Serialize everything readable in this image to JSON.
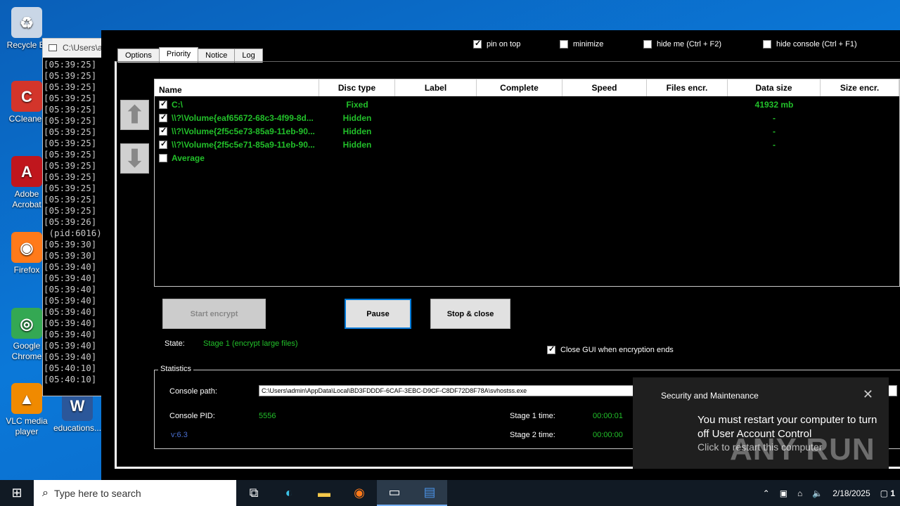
{
  "desktop": {
    "icons": [
      {
        "label": "Recycle Bi",
        "glyph": "♻",
        "color": "#c9d6e6"
      },
      {
        "label": "CCleaner",
        "glyph": "C",
        "color": "#d3352b"
      },
      {
        "label": "Adobe Acrobat",
        "glyph": "A",
        "color": "#c0161d"
      },
      {
        "label": "Firefox",
        "glyph": "◉",
        "color": "#ff7a1a"
      },
      {
        "label": "Google Chrome",
        "glyph": "◎",
        "color": "#34a853"
      },
      {
        "label": "VLC media player",
        "glyph": "▲",
        "color": "#f08a00"
      },
      {
        "label": "educations...",
        "glyph": "W",
        "color": "#2b579a"
      }
    ]
  },
  "console": {
    "title": "C:\\Users\\a",
    "lines": "[05:39:25]\n[05:39:25]\n[05:39:25]\n[05:39:25]\n[05:39:25]\n[05:39:25]\n[05:39:25]\n[05:39:25]\n[05:39:25]\n[05:39:25]\n[05:39:25]\n[05:39:25]\n[05:39:25]\n[05:39:25]\n[05:39:26]\n (pid:6016)\n[05:39:30]\n[05:39:30]\n[05:39:40]\n[05:39:40]\n[05:39:40]\n[05:39:40]\n[05:39:40]\n[05:39:40]\n[05:39:40]\n[05:39:40]\n[05:39:40]\n[05:40:10]\n[05:40:10]"
  },
  "app": {
    "tabs": [
      "Options",
      "Priority",
      "Notice",
      "Log"
    ],
    "active_tab": "Priority",
    "top_checks": [
      {
        "label": "pin on top",
        "checked": true
      },
      {
        "label": "minimize",
        "checked": false
      },
      {
        "label": "hide me (Ctrl + F2)",
        "checked": false
      },
      {
        "label": "hide console (Ctrl + F1)",
        "checked": false
      }
    ],
    "table": {
      "headers": [
        "Name",
        "Disc type",
        "Label",
        "Complete",
        "Speed",
        "Files encr.",
        "Data size",
        "Size encr."
      ],
      "rows": [
        {
          "name": "C:\\",
          "disc": "Fixed",
          "size": "41932 mb",
          "checked": true
        },
        {
          "name": "\\\\?\\Volume{eaf65672-68c3-4f99-8d...",
          "disc": "Hidden",
          "size": "-",
          "checked": true
        },
        {
          "name": "\\\\?\\Volume{2f5c5e73-85a9-11eb-90...",
          "disc": "Hidden",
          "size": "-",
          "checked": true
        },
        {
          "name": "\\\\?\\Volume{2f5c5e71-85a9-11eb-90...",
          "disc": "Hidden",
          "size": "-",
          "checked": true
        },
        {
          "name": "Average",
          "disc": "",
          "size": "",
          "checked": false
        }
      ]
    },
    "buttons": {
      "start": "Start encrypt",
      "pause": "Pause",
      "stop": "Stop & close"
    },
    "state_label": "State:",
    "state_value": "Stage 1 (encrypt large files)",
    "close_gui": {
      "label": "Close GUI when encryption ends",
      "checked": true
    },
    "stats": {
      "title": "Statistics",
      "console_path_label": "Console path:",
      "console_path": "C:\\Users\\admin\\AppData\\Local\\BD3FDDDF-6CAF-3EBC-D9CF-C8DF72D8F78A\\svhostss.exe",
      "console_pid_label": "Console PID:",
      "console_pid": "5556",
      "version": "v:6.3",
      "stage1_label": "Stage 1 time:",
      "stage1": "00:00:01",
      "stage2_label": "Stage 2 time:",
      "stage2": "00:00:00"
    }
  },
  "toast": {
    "title": "Security and Maintenance",
    "body": "You must restart your computer to turn off User Account Control",
    "sub": "Click to restart this computer"
  },
  "watermark": "ANY RUN",
  "taskbar": {
    "search_placeholder": "Type here to search",
    "date": "2/18/2025",
    "notif_count": "1"
  }
}
